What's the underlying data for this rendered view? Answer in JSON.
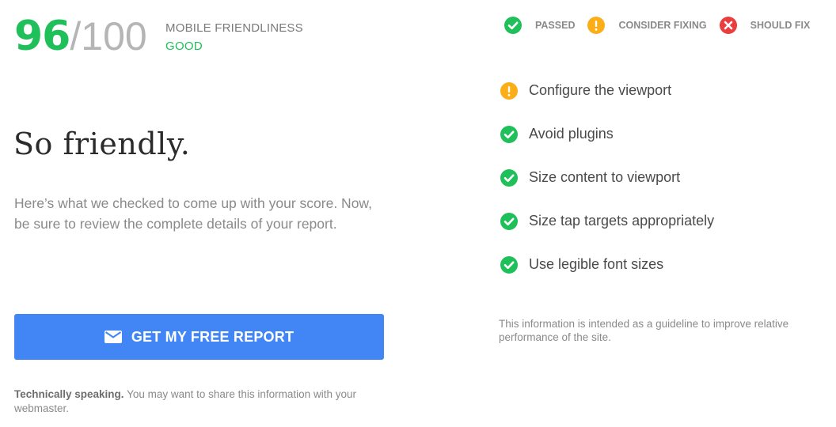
{
  "colors": {
    "passed": "#1fbf5a",
    "consider": "#fbae17",
    "should_fix": "#eb3d3d",
    "accent": "#4286f5"
  },
  "score": {
    "value": "96",
    "max": "/100",
    "title": "MOBILE FRIENDLINESS",
    "rating": "GOOD"
  },
  "headline": "So friendly.",
  "intro": "Here’s what we checked to come up with your score. Now, be sure to review the complete details of your report.",
  "report_button": {
    "icon": "mail-icon",
    "label": "GET MY FREE REPORT"
  },
  "tech_note": {
    "bold": "Technically speaking.",
    "text": " You may want to share this information with your webmaster."
  },
  "legend": [
    {
      "status": "passed",
      "icon": "check-circle-icon",
      "label": "PASSED"
    },
    {
      "status": "consider",
      "icon": "exclamation-circle-icon",
      "label": "CONSIDER FIXING"
    },
    {
      "status": "should_fix",
      "icon": "x-circle-icon",
      "label": "SHOULD FIX"
    }
  ],
  "checks": [
    {
      "status": "consider",
      "label": "Configure the viewport"
    },
    {
      "status": "passed",
      "label": "Avoid plugins"
    },
    {
      "status": "passed",
      "label": "Size content to viewport"
    },
    {
      "status": "passed",
      "label": "Size tap targets appropriately"
    },
    {
      "status": "passed",
      "label": "Use legible font sizes"
    }
  ],
  "disclaimer": "This information is intended as a guideline to improve relative performance of the site."
}
